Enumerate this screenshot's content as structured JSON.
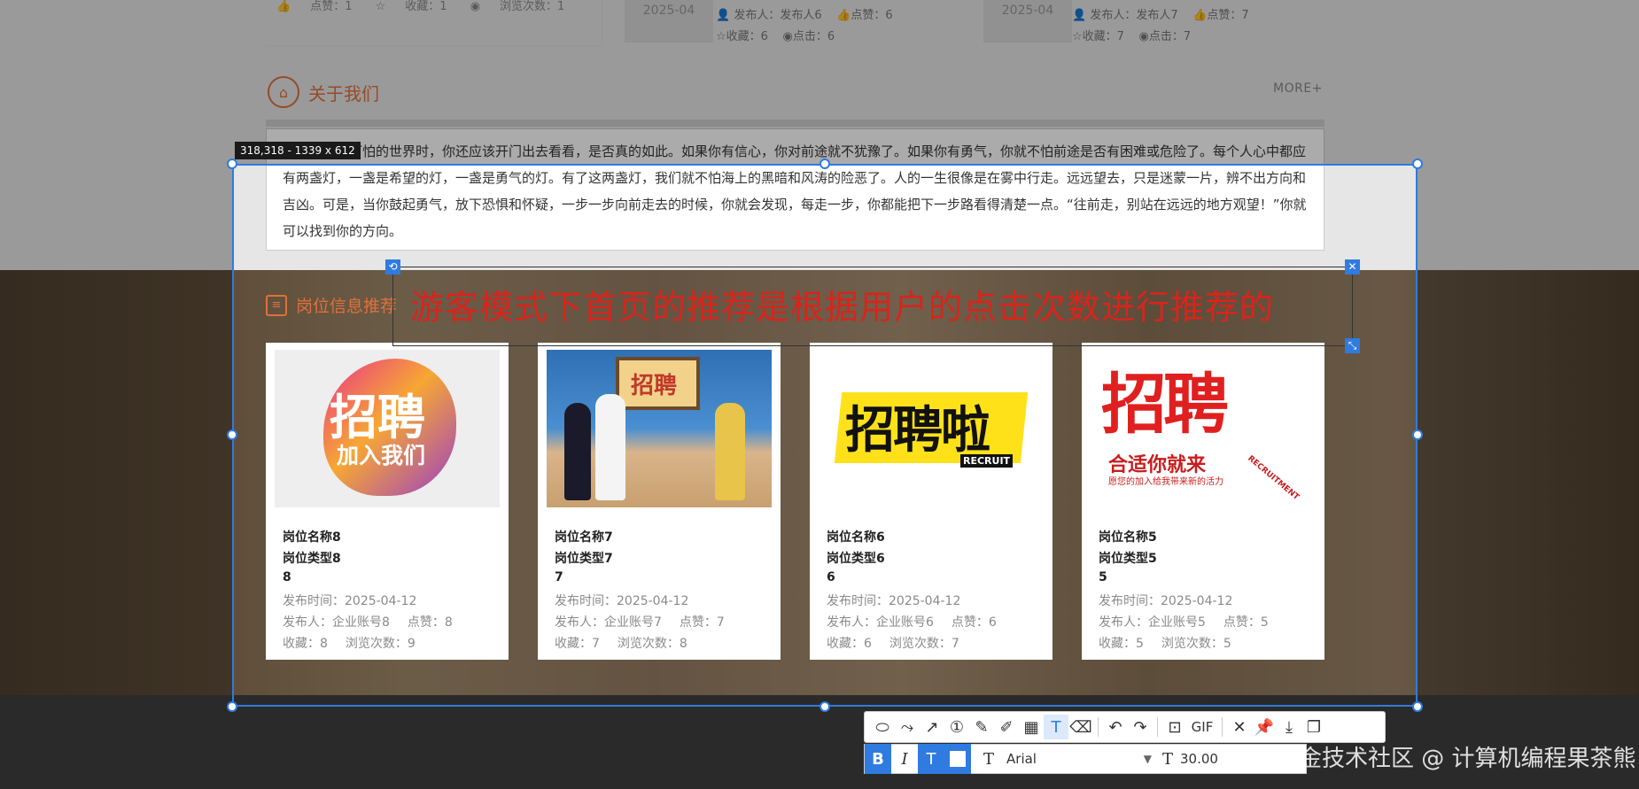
{
  "top_strip": {
    "card1": {
      "likes": "点赞：1",
      "favorites": "收藏：1",
      "views": "浏览次数：1"
    },
    "card2": {
      "date": "2025-04",
      "publisher": "发布人：发布人6",
      "likes": "点赞：6",
      "favorites": "收藏：6",
      "clicks": "点击：6"
    },
    "card3": {
      "date": "2025-04",
      "publisher": "发布人：发布人7",
      "likes": "点赞：7",
      "favorites": "收藏：7",
      "clicks": "点击：7"
    }
  },
  "about": {
    "title": "关于我们",
    "more": "MORE+",
    "text": "外面是寒冷可怕的世界时，你还应该开门出去看看，是否真的如此。如果你有信心，你对前途就不犹豫了。如果你有勇气，你就不怕前途是否有困难或危险了。每个人心中都应有两盏灯，一盏是希望的灯，一盏是勇气的灯。有了这两盏灯，我们就不怕海上的黑暗和风涛的险恶了。人的一生很像是在雾中行走。远远望去，只是迷蒙一片，辨不出方向和吉凶。可是，当你鼓起勇气，放下恐惧和怀疑，一步一步向前走去的时候，你就会发现，每走一步，你都能把下一步路看得清楚一点。“往前走，别站在远远的地方观望！”你就可以找到你的方向。"
  },
  "jobs": {
    "title": "岗位信息推荐",
    "cards": [
      {
        "name": "岗位名称8",
        "type": "岗位类型8",
        "num": "8",
        "time": "发布时间：2025-04-12",
        "publisher": "发布人：企业账号8",
        "likes": "点赞：8",
        "favorites": "收藏：8",
        "views": "浏览次数：9",
        "poster_main": "招聘",
        "poster_sub": "加入我们"
      },
      {
        "name": "岗位名称7",
        "type": "岗位类型7",
        "num": "7",
        "time": "发布时间：2025-04-12",
        "publisher": "发布人：企业账号7",
        "likes": "点赞：7",
        "favorites": "收藏：7",
        "views": "浏览次数：8",
        "poster_main": "招聘"
      },
      {
        "name": "岗位名称6",
        "type": "岗位类型6",
        "num": "6",
        "time": "发布时间：2025-04-12",
        "publisher": "发布人：企业账号6",
        "likes": "点赞：6",
        "favorites": "收藏：6",
        "views": "浏览次数：7",
        "poster_main": "招聘啦",
        "poster_sub": "RECRUIT"
      },
      {
        "name": "岗位名称5",
        "type": "岗位类型5",
        "num": "5",
        "time": "发布时间：2025-04-12",
        "publisher": "发布人：企业账号5",
        "likes": "点赞：5",
        "favorites": "收藏：5",
        "views": "浏览次数：5",
        "poster_main": "招聘",
        "poster_sub": "合适你就来",
        "poster_small": "愿您的加入给我带来新的活力",
        "poster_tag": "RECRUITMENT"
      }
    ]
  },
  "capture": {
    "dim_label": "318,318 - 1339 x 612",
    "annotation_text": "游客模式下首页的推荐是根据用户的点击次数进行推荐的"
  },
  "toolbar": {
    "gif_label": "GIF",
    "font_name": "Arial",
    "font_size": "30.00"
  },
  "watermark": "掘金技术社区 @ 计算机编程果茶熊",
  "colors": {
    "accent": "#e0703a",
    "selection": "#2f7be0",
    "annotation": "#d9241b"
  }
}
